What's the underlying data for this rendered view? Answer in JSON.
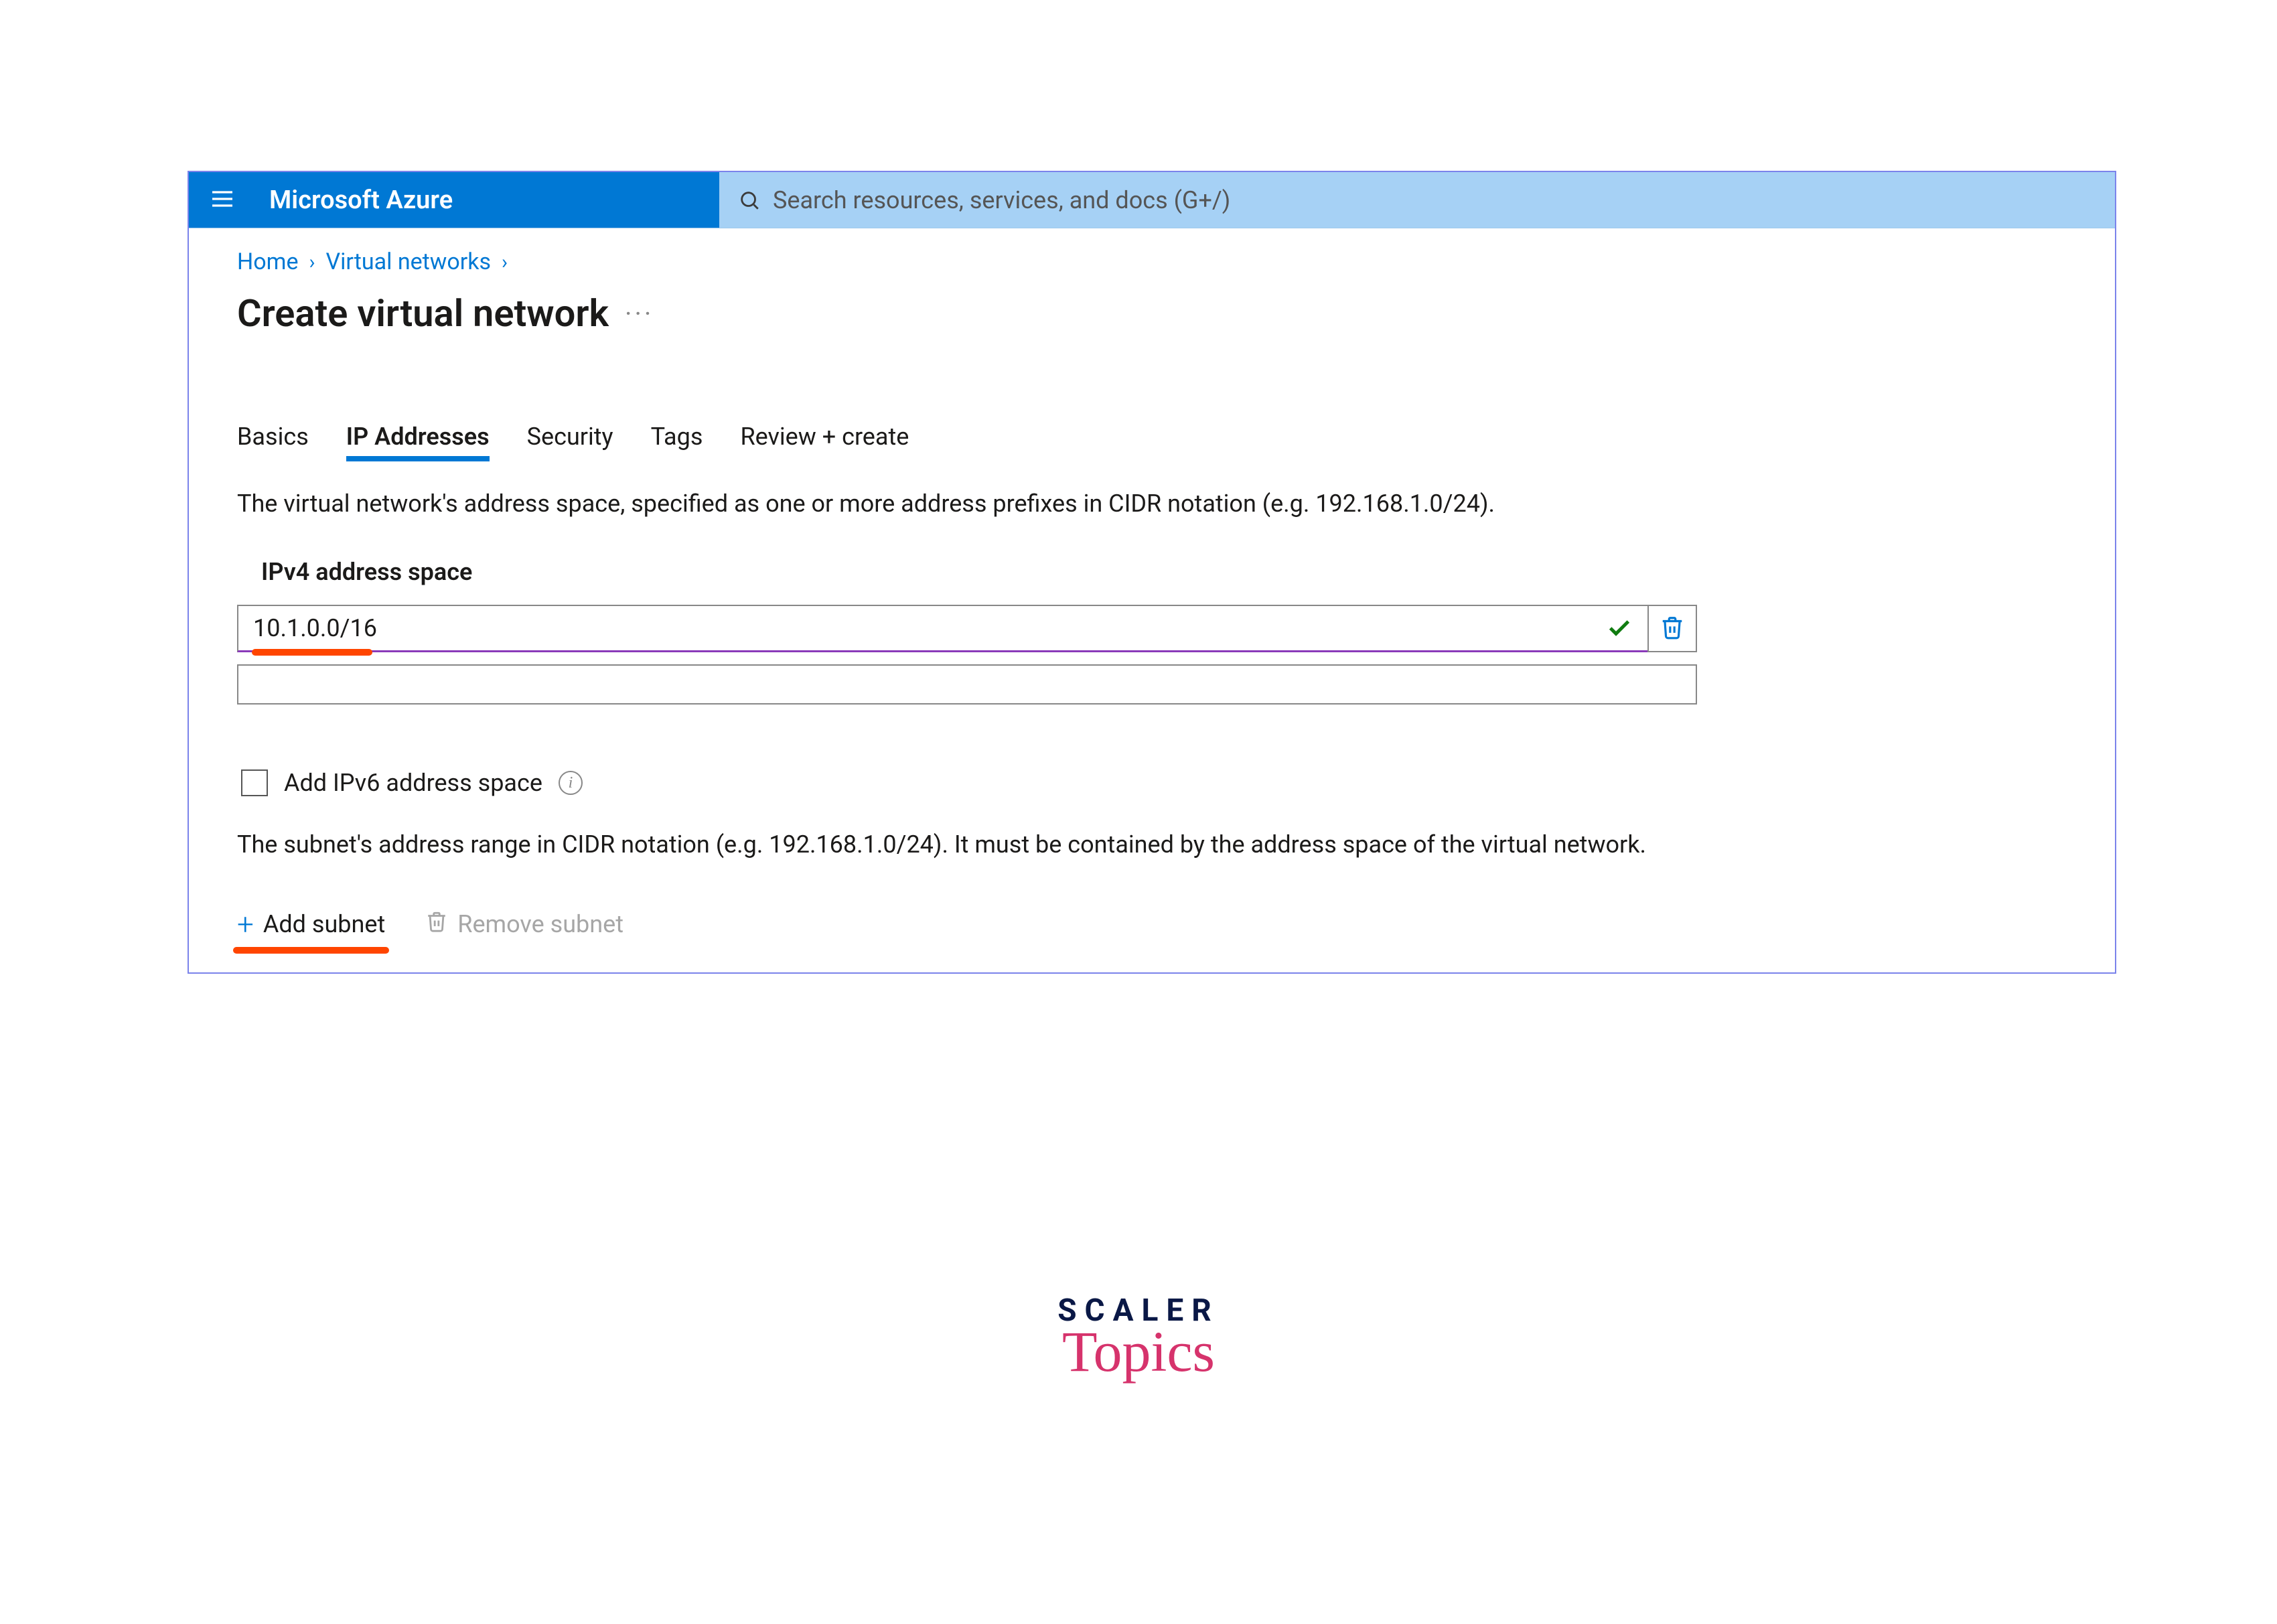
{
  "header": {
    "brand": "Microsoft Azure",
    "search_placeholder": "Search resources, services, and docs (G+/)"
  },
  "breadcrumbs": {
    "items": [
      "Home",
      "Virtual networks"
    ]
  },
  "page": {
    "title": "Create virtual network"
  },
  "tabs": {
    "items": [
      "Basics",
      "IP Addresses",
      "Security",
      "Tags",
      "Review + create"
    ],
    "active_index": 1
  },
  "ip": {
    "description": "The virtual network's address space, specified as one or more address prefixes in CIDR notation (e.g. 192.168.1.0/24).",
    "section_label": "IPv4 address space",
    "address_value": "10.1.0.0/16",
    "ipv6_checkbox_label": "Add IPv6 address space",
    "subnet_description": "The subnet's address range in CIDR notation (e.g. 192.168.1.0/24). It must be contained by the address space of the virtual network.",
    "add_subnet_label": "Add subnet",
    "remove_subnet_label": "Remove subnet"
  },
  "logo": {
    "line1": "SCALER",
    "line2": "Topics"
  }
}
